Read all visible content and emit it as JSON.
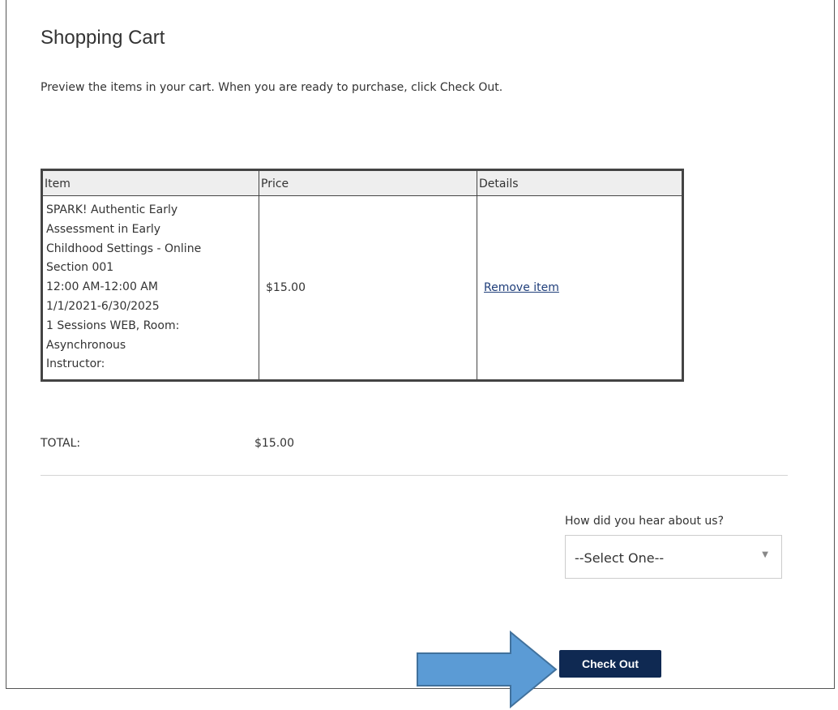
{
  "page": {
    "title": "Shopping Cart",
    "intro": "Preview the items in your cart. When you are ready to purchase, click Check Out."
  },
  "cart": {
    "columns": [
      "Item",
      "Price",
      "Details"
    ],
    "items": [
      {
        "lines": [
          "SPARK! Authentic Early",
          "Assessment in Early",
          "Childhood Settings - Online",
          "Section 001",
          "12:00 AM-12:00 AM",
          "1/1/2021-6/30/2025",
          "1 Sessions WEB, Room:",
          "Asynchronous",
          "Instructor:"
        ],
        "price": "$15.00",
        "details_link": "Remove item"
      }
    ],
    "total_label": "TOTAL:",
    "total_value": "$15.00"
  },
  "referral": {
    "label": "How did you hear about us?",
    "selected": "--Select One--"
  },
  "actions": {
    "checkout_label": "Check Out"
  },
  "colors": {
    "checkout_bg": "#0f2952",
    "link": "#1f3e7a",
    "arrow_fill": "#5b9bd5",
    "arrow_stroke": "#41719c"
  },
  "icons": {
    "select_arrow": "caret-down-icon",
    "pointer_arrow": "right-arrow-icon"
  }
}
